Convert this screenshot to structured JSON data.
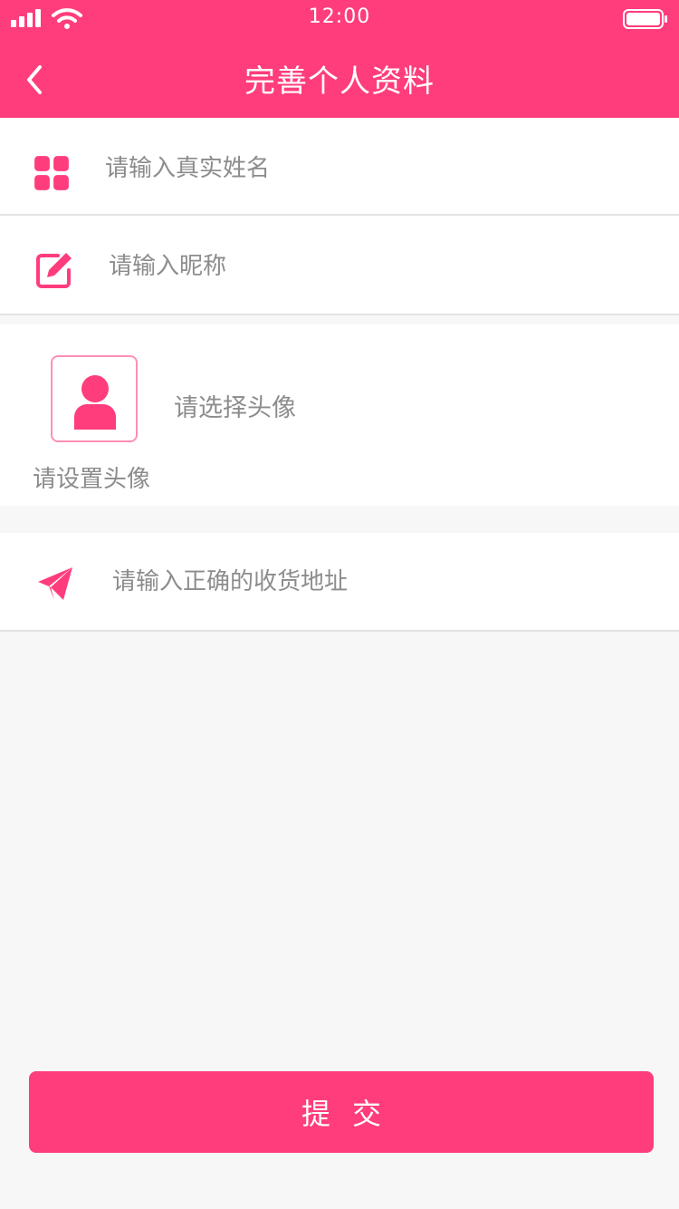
{
  "status_bar": {
    "time": "12:00"
  },
  "header": {
    "title": "完善个人资料",
    "back_icon": "chevron-left-icon"
  },
  "form": {
    "real_name": {
      "icon": "grid-icon",
      "placeholder": "请输入真实姓名",
      "value": ""
    },
    "nickname": {
      "icon": "edit-icon",
      "placeholder": "请输入昵称",
      "value": ""
    },
    "avatar": {
      "icon": "user-icon",
      "caption": "请设置头像",
      "prompt": "请选择头像"
    },
    "address": {
      "icon": "paper-plane-icon",
      "placeholder": "请输入正确的收货地址",
      "value": ""
    }
  },
  "submit_label": "提交",
  "colors": {
    "accent": "#ff3d7c",
    "avatar_border": "#ff8fb4",
    "placeholder": "#8c8c8c",
    "background": "#f7f7f7"
  }
}
